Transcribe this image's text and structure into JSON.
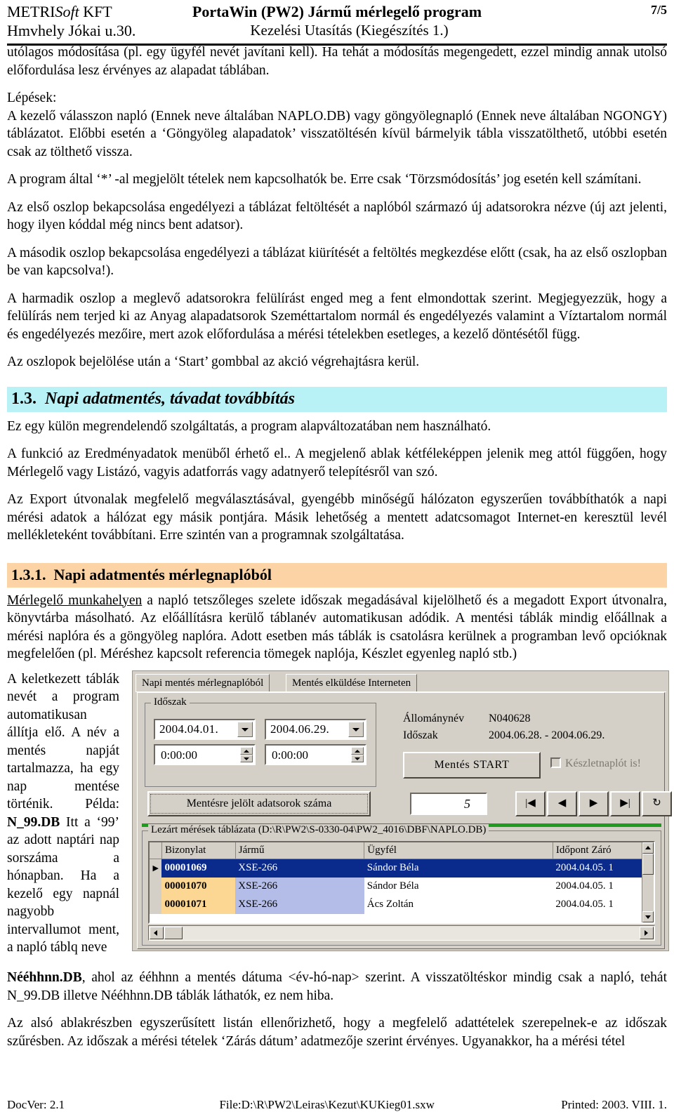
{
  "header": {
    "company_prefix": "METRI",
    "company_italic": "Soft",
    "company_suffix": " KFT",
    "address": "Hmvhely Jókai u.30.",
    "title": "PortaWin (PW2) Jármű mérlegelő program",
    "subtitle": "Kezelési Utasítás (Kiegészítés 1.)",
    "page_number": "7/5"
  },
  "body": {
    "p1": "utólagos módosítása (pl. egy ügyfél nevét javítani kell). Ha tehát a módosítás megengedett, ezzel mindig annak utolsó előfordulása lesz érvényes az alapadat táblában.",
    "steps_label": "Lépések:",
    "p2": "A kezelő válasszon napló (Ennek neve általában NAPLO.DB) vagy göngyölegnapló (Ennek neve általában NGONGY) táblázatot. Előbbi esetén a ‘Göngyöleg alapadatok’ visszatöltésén kívül bármelyik tábla visszatölthető, utóbbi esetén csak az tölthető vissza.",
    "p3": "A program által ‘*’ -al megjelölt tételek nem kapcsolhatók be. Erre csak ‘Törzsmódosítás’ jog esetén kell számítani.",
    "p4": "Az első oszlop bekapcsolása engedélyezi a táblázat feltöltését a naplóból származó új adatsorokra nézve (új azt jelenti, hogy ilyen kóddal még nincs bent adatsor).",
    "p5": "A második oszlop bekapcsolása engedélyezi a táblázat kiürítését a feltöltés megkezdése előtt (csak, ha az első oszlopban be van kapcsolva!).",
    "p6": "A harmadik oszlop a meglevő adatsorokra felülírást enged meg a fent elmondottak szerint. Megjegyezzük, hogy a felülírás nem terjed ki az Anyag alapadatsorok Szeméttartalom normál és engedélyezés valamint a Víztartalom normál és engedélyezés mezőire, mert azok előfordulása a mérési tételekben esetleges, a kezelő döntésétől függ.",
    "p7": "Az oszlopok bejelölése után a ‘Start’ gombbal az akció végrehajtásra kerül."
  },
  "section_13": {
    "number": "1.3.",
    "title": "Napi adatmentés, távadat továbbítás",
    "p1": "Ez egy külön megrendelendő szolgáltatás, a program alapváltozatában nem használható.",
    "p2": "A funkció az Eredményadatok menüből érhető el.. A megjelenő ablak kétféleképpen jelenik meg attól függően, hogy Mérlegelő vagy Listázó, vagyis adatforrás vagy adatnyerő telepítésről van szó.",
    "p3": "Az Export útvonalak megfelelő megválasztásával, gyengébb minőségű hálózaton egyszerűen továbbíthatók a napi mérési adatok a hálózat egy másik pontjára. Másik lehetőség a mentett adatcsomagot Internet-en keresztül levél mellékleteként továbbítani. Erre szintén van a programnak szolgáltatása."
  },
  "section_131": {
    "number": "1.3.1.",
    "title": "Napi adatmentés mérlegnaplóból",
    "p1_underlined": "Mérlegelő munkahelyen",
    "p1_rest": " a napló tetszőleges szelete időszak megadásával kijelölhető és a megadott Export útvonalra, könyvtárba másolható. Az előállításra kerülő táblanév automatikusan adódik. A mentési táblák mindig előállnak a mérési naplóra és a göngyöleg naplóra. Adott esetben más táblák is csatolásra kerülnek a programban levő opcióknak megfelelően (pl. Méréshez kapcsolt referencia tömegek naplója, Készlet egyenleg napló stb.)",
    "sidecol_a": "A keletkezett táblák nevét a program automatikusan állítja elő. A név a mentés napját tartalmazza, ha egy nap mentése történik. Példa: ",
    "sidecol_bold": "N_99.DB",
    "sidecol_b": " Itt a ‘99’ az adott naptári nap sorszáma a hónapban. Ha a kezelő egy napnál nagyobb intervallumot ment, a napló táblq neve",
    "after_bold": "Nééhhnn.DB",
    "after_rest": ", ahol az ééhhnn a mentés dátuma <év-hó-nap> szerint. A visszatöltéskor mindig csak a napló, tehát N_99.DB illetve Nééhhnn.DB táblák láthatók, ez nem hiba.",
    "p_last": "Az alsó ablakrészben egyszerűsített listán ellenőrizhető, hogy a megfelelő adattételek szerepelnek-e az időszak szűrésben. Az időszak a mérési tételek ‘Zárás dátum’ adatmezője szerint érvényes. Ugyanakkor, ha a mérési tétel"
  },
  "app": {
    "tabs": [
      {
        "label": "Napi mentés mérlegnaplóból",
        "active": true
      },
      {
        "label": "Mentés elküldése Interneten",
        "active": false
      }
    ],
    "period_group_label": "Időszak",
    "date_from": "2004.04.01.",
    "date_to": "2004.06.29.",
    "time_from": "0:00:00",
    "time_to": "0:00:00",
    "info": {
      "filename_label": "Állománynév",
      "filename_value": "N040628",
      "period_label": "Időszak",
      "period_value": "2004.06.28. - 2004.06.29."
    },
    "start_button": "Mentés START",
    "checkbox_label": "Készletnaplót is!",
    "count_button": "Mentésre jelölt adatsorok száma",
    "count_value": "5",
    "nav_buttons": [
      {
        "name": "first-record-button",
        "glyph": "|◀"
      },
      {
        "name": "prev-record-button",
        "glyph": "◀"
      },
      {
        "name": "next-record-button",
        "glyph": "▶"
      },
      {
        "name": "last-record-button",
        "glyph": "▶|"
      },
      {
        "name": "refresh-button",
        "glyph": "↻"
      }
    ],
    "grid_group_label": "Lezárt mérések táblázata (D:\\R\\PW2\\S-0330-04\\PW2_4016\\DBF\\NAPLO.DB)",
    "grid_columns": [
      "Bizonylat",
      "Jármű",
      "Ügyfél",
      "Időpont Záró"
    ],
    "grid_rows": [
      {
        "selected": true,
        "bizonylat": "00001069",
        "jarmu": "XSE-266",
        "ugyfel": "Sándor Béla",
        "idopont": "2004.04.05. 1"
      },
      {
        "selected": false,
        "bizonylat": "00001070",
        "jarmu": "XSE-266",
        "ugyfel": "Sándor Béla",
        "idopont": "2004.04.05. 1"
      },
      {
        "selected": false,
        "bizonylat": "00001071",
        "jarmu": "XSE-266",
        "ugyfel": "Ács Zoltán",
        "idopont": "2004.04.05. 1"
      }
    ]
  },
  "footer": {
    "docver": "DocVer: 2.1",
    "file": "File:D:\\R\\PW2\\Leiras\\Kezut\\KUKieg01.sxw",
    "printed": "Printed: 2003. VIII. 1."
  },
  "colors": {
    "h2_bg": "#b8f2f7",
    "h3_bg": "#fbd3a5",
    "dialog_bg": "#d4d0c8",
    "grid_selected": "#0a2a8c",
    "grid_biz_cell": "#fcd793",
    "grid_jar_cell": "#b4bde8",
    "green_separator": "#1f9b1f"
  }
}
